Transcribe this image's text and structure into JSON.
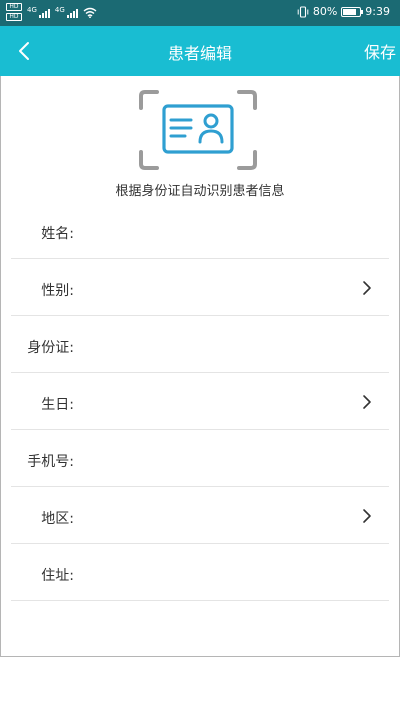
{
  "status_bar": {
    "sim1": "HD",
    "sim2": "HD",
    "network1": "4G",
    "network2": "4G",
    "battery_text": "80%",
    "battery_level": 0.8,
    "time": "9:39"
  },
  "nav": {
    "title": "患者编辑",
    "save_label": "保存",
    "back_icon": "chevron-left-icon"
  },
  "scan": {
    "icon": "id-card-scan-icon",
    "caption": "根据身份证自动识别患者信息"
  },
  "form": {
    "fields": [
      {
        "label": "姓名:",
        "value": "",
        "has_arrow": false
      },
      {
        "label": "性别:",
        "value": "",
        "has_arrow": true
      },
      {
        "label": "身份证:",
        "value": "",
        "has_arrow": false
      },
      {
        "label": "生日:",
        "value": "",
        "has_arrow": true
      },
      {
        "label": "手机号:",
        "value": "",
        "has_arrow": false
      },
      {
        "label": "地区:",
        "value": "",
        "has_arrow": true
      },
      {
        "label": "住址:",
        "value": "",
        "has_arrow": false
      }
    ]
  },
  "colors": {
    "status_bar": "#1b6a73",
    "nav_bar": "#19bdd2",
    "icon_blue": "#2f9fd1",
    "scan_corner": "#9b9b9b"
  }
}
